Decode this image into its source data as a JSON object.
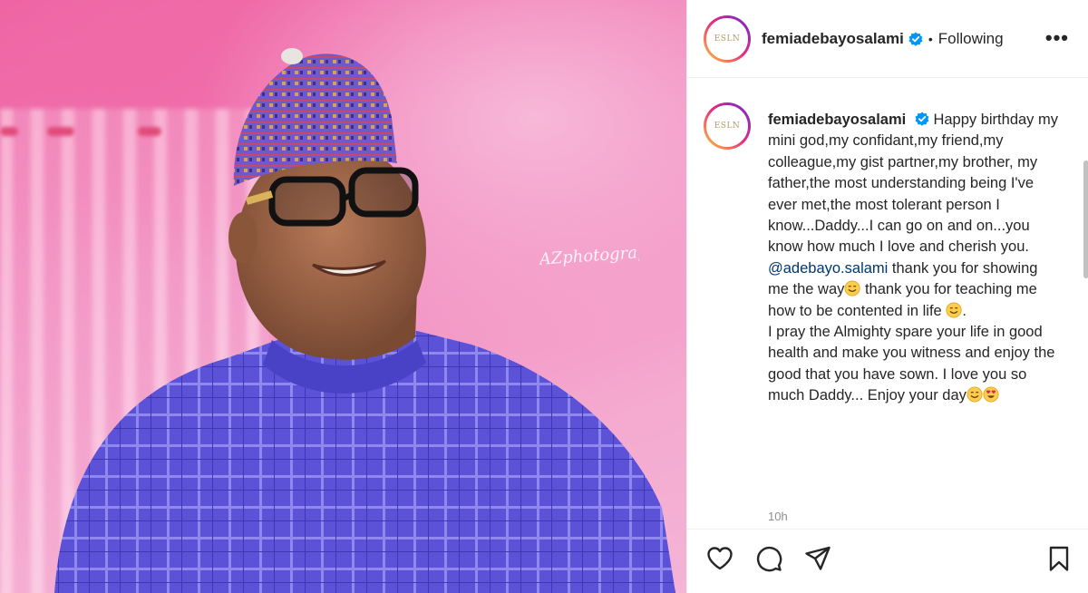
{
  "post": {
    "watermark": "AZphotography"
  },
  "header": {
    "avatar_logo": "ESLN",
    "username": "femiadebayosalami",
    "separator": "•",
    "follow_status": "Following",
    "more_label": "•••"
  },
  "caption": {
    "username": "femiadebayosalami",
    "text_part1": "Happy birthday my mini god,my confidant,my friend,my colleague,my gist partner,my brother, my father,the most understanding being I've ever met,the most tolerant person I know...Daddy...I can go on and on...you know how much I love and cherish you.",
    "mention": "@adebayo.salami",
    "text_part2": " thank you for showing me the way",
    "text_part3": " thank you for teaching me how to be contented in life ",
    "text_part4": ".",
    "text_part5": "I pray the Almighty spare your life in good health and make you witness and enjoy the good that you have sown. I love you so much Daddy... Enjoy your day",
    "timestamp": "10h"
  },
  "icons": {
    "like": "heart-icon",
    "comment": "comment-icon",
    "share": "paper-plane-icon",
    "save": "bookmark-icon",
    "verified": "verified-badge-icon",
    "smile_emoji": "smiling-face-emoji",
    "heart_eyes_emoji": "heart-eyes-emoji"
  },
  "colors": {
    "verified_blue": "#0095f6",
    "mention_blue": "#00376b",
    "robe_blue": "#5a4fd6",
    "background_pink": "#f28cc0"
  }
}
